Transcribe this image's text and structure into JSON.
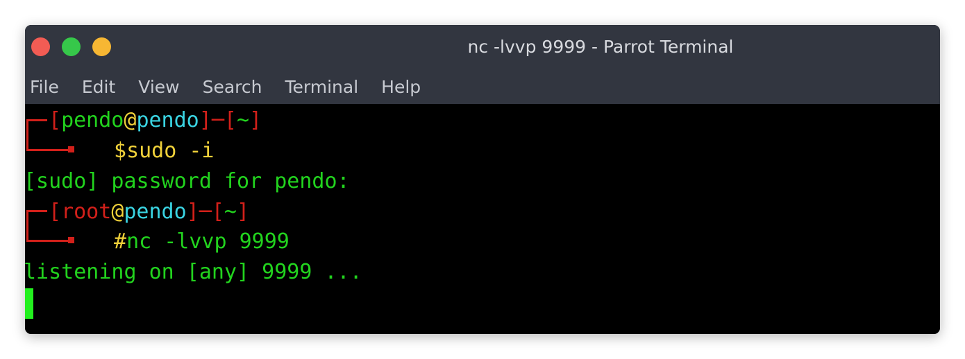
{
  "window": {
    "title": "nc -lvvp 9999 - Parrot Terminal"
  },
  "menu": [
    "File",
    "Edit",
    "View",
    "Search",
    "Terminal",
    "Help"
  ],
  "prompt1": {
    "open": "[",
    "user": "pendo",
    "at": "@",
    "host": "pendo",
    "close": "]",
    "dash": "─",
    "dir_open": "[",
    "dir": "~",
    "dir_close": "]",
    "symbol": "$",
    "command": "sudo -i"
  },
  "sudo_line": "[sudo] password for pendo:",
  "prompt2": {
    "open": "[",
    "user": "root",
    "at": "@",
    "host": "pendo",
    "close": "]",
    "dash": "─",
    "dir_open": "[",
    "dir": "~",
    "dir_close": "]",
    "symbol": "#",
    "command": "nc -lvvp 9999"
  },
  "output_line": "listening on [any] 9999 ...",
  "colors": {
    "red": "#d2201a",
    "green": "#22d31e",
    "cyan": "#3ad4e2",
    "yellow": "#f0d13a",
    "titlebar": "#323640"
  },
  "icons": [
    "close-icon",
    "minimize-icon",
    "maximize-icon"
  ]
}
